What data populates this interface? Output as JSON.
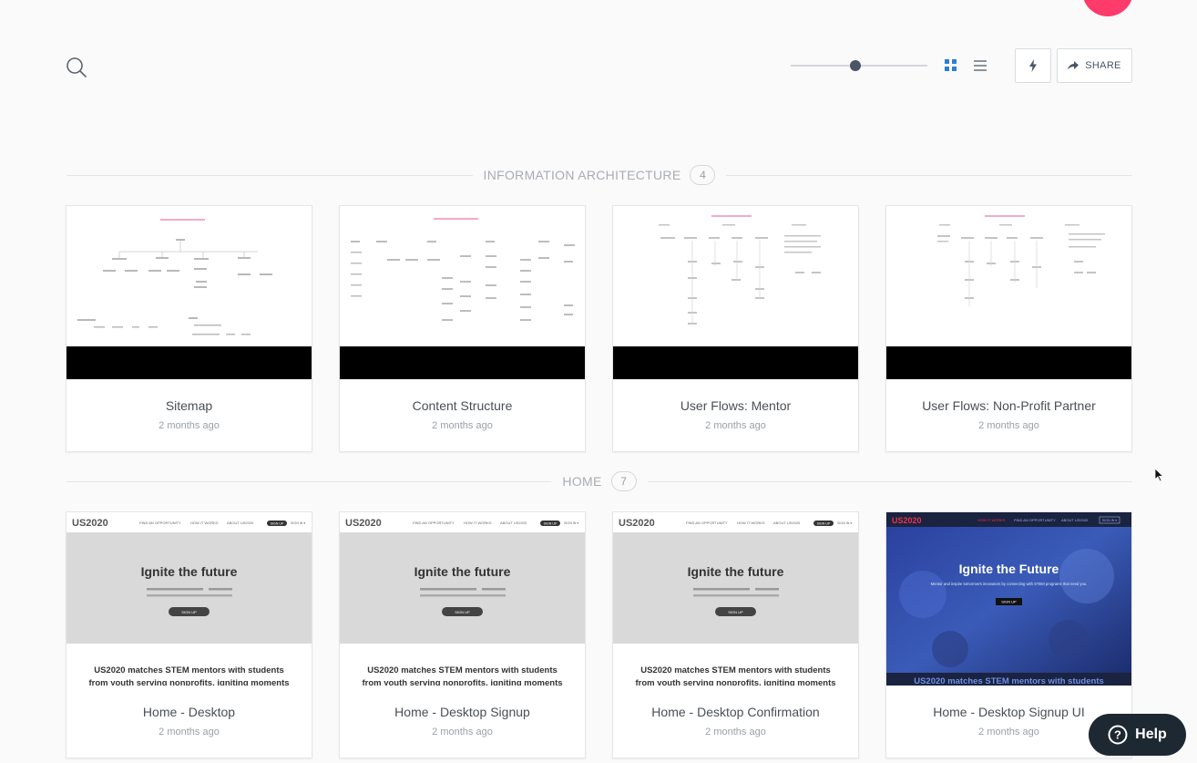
{
  "toolbar": {
    "zoom_level": 0.47,
    "share_label": "SHARE",
    "icons": {
      "search": "search-icon",
      "grid": "grid-view-icon",
      "list": "list-view-icon",
      "bolt": "lightning-icon",
      "share": "share-arrow-icon"
    }
  },
  "sections": [
    {
      "title": "INFORMATION ARCHITECTURE",
      "count": "4",
      "cards": [
        {
          "title": "Sitemap",
          "date": "2 months ago"
        },
        {
          "title": "Content Structure",
          "date": "2 months ago"
        },
        {
          "title": "User Flows: Mentor",
          "date": "2 months ago"
        },
        {
          "title": "User Flows: Non-Profit Partner",
          "date": "2 months ago"
        }
      ]
    },
    {
      "title": "HOME",
      "count": "7",
      "cards": [
        {
          "title": "Home - Desktop",
          "date": "2 months ago"
        },
        {
          "title": "Home - Desktop Signup",
          "date": "2 months ago"
        },
        {
          "title": "Home - Desktop Confirmation",
          "date": "2 months ago"
        },
        {
          "title": "Home - Desktop Signup UI",
          "date": "2 months ago"
        }
      ]
    }
  ],
  "mockups": {
    "logo": "US2020",
    "nav_items": [
      "FIND AN OPPORTUNITY",
      "HOW IT WORKS",
      "ABOUT US2020"
    ],
    "signup_pill": "SIGN UP",
    "signin": "SIGN IN ▾",
    "hero_wire": "Ignite the future",
    "hero_ui": "Ignite the Future",
    "hero_sub_ui": "Mentor and inspire tomorrow's innovators by connecting with STEM programs that need you.",
    "cta": "SIGN UP",
    "tagline_1": "US2020 matches STEM mentors with students",
    "tagline_2": "from youth serving nonprofits, igniting moments"
  },
  "help": {
    "label": "Help",
    "icon": "question-circle-icon"
  },
  "colors": {
    "accent": "#2b7fd3",
    "avatar": "#ff3b6b",
    "help_bg": "#1e2833",
    "ui_brand_red": "#e8344e",
    "ui_hero_blue": "#2a3f9c"
  }
}
